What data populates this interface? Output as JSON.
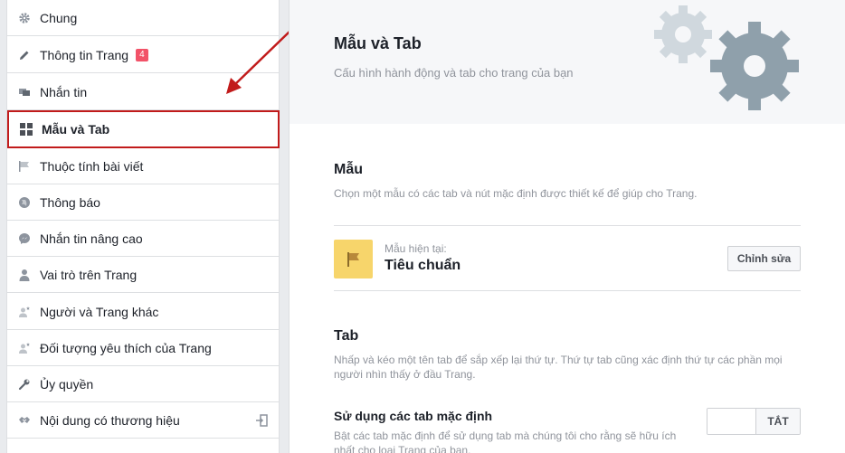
{
  "sidebar": {
    "items": [
      {
        "label": "Chung",
        "icon": "gear-icon"
      },
      {
        "label": "Thông tin Trang",
        "icon": "pencil-icon",
        "badge": "4"
      },
      {
        "label": "Nhắn tin",
        "icon": "chat-bubbles-icon"
      },
      {
        "label": "Mẫu và Tab",
        "icon": "grid-icon",
        "active": true
      },
      {
        "label": "Thuộc tính bài viết",
        "icon": "flag-icon"
      },
      {
        "label": "Thông báo",
        "icon": "globe-icon"
      },
      {
        "label": "Nhắn tin nâng cao",
        "icon": "messenger-icon"
      },
      {
        "label": "Vai trò trên Trang",
        "icon": "person-icon"
      },
      {
        "label": "Người và Trang khác",
        "icon": "person-star-icon"
      },
      {
        "label": "Đối tượng yêu thích của Trang",
        "icon": "person-star-icon"
      },
      {
        "label": "Ủy quyền",
        "icon": "wrench-icon"
      },
      {
        "label": "Nội dung có thương hiệu",
        "icon": "handshake-icon",
        "trailing_icon": "sign-in-icon"
      }
    ]
  },
  "header": {
    "title": "Mẫu và Tab",
    "subtitle": "Cấu hình hành động và tab cho trang của bạn"
  },
  "template_section": {
    "title": "Mẫu",
    "description": "Chọn một mẫu có các tab và nút mặc định được thiết kế để giúp cho Trang.",
    "current_caption": "Mẫu hiện tại:",
    "current_name": "Tiêu chuẩn",
    "edit_button": "Chỉnh sửa"
  },
  "tab_section": {
    "title": "Tab",
    "description": "Nhấp và kéo một tên tab để sắp xếp lại thứ tự. Thứ tự tab cũng xác định thứ tự các phần mọi người nhìn thấy ở đầu Trang.",
    "default_tabs_title": "Sử dụng các tab mặc định",
    "default_tabs_desc": "Bật các tab mặc định để sử dụng tab mà chúng tôi cho rằng sẽ hữu ích nhất cho loại Trang của bạn.",
    "toggle_label": "TẮT"
  },
  "colors": {
    "accent_red": "#c11b1b",
    "badge": "#f25268",
    "template_icon_bg": "#f7d56b",
    "gear_dark": "#8fa0ab",
    "gear_light": "#d0d8de"
  }
}
